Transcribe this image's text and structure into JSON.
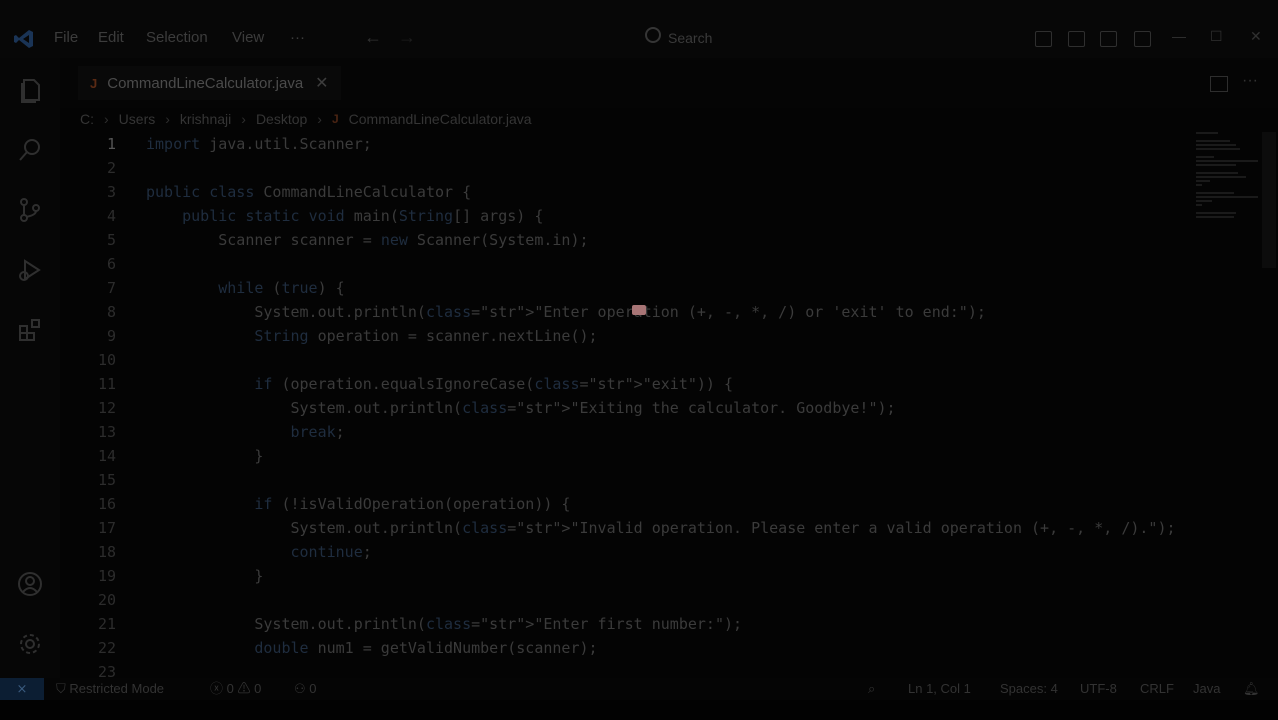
{
  "menu": {
    "file": "File",
    "edit": "Edit",
    "selection": "Selection",
    "view": "View",
    "more": "···"
  },
  "title_search": "Search",
  "tab": {
    "icon": "J",
    "label": "CommandLineCalculator.java",
    "close": "✕"
  },
  "breadcrumb": [
    "C:",
    "Users",
    "krishnaji",
    "Desktop",
    "CommandLineCalculator.java"
  ],
  "breadcrumb_java_icon": "J",
  "editor": {
    "line_numbers": [
      "1",
      "2",
      "3",
      "4",
      "5",
      "6",
      "7",
      "8",
      "9",
      "10",
      "11",
      "12",
      "13",
      "14",
      "15",
      "16",
      "17",
      "18",
      "19",
      "20",
      "21",
      "22",
      "23"
    ],
    "code_lines": [
      "import java.util.Scanner;",
      "",
      "public class CommandLineCalculator {",
      "    public static void main(String[] args) {",
      "        Scanner scanner = new Scanner(System.in);",
      "",
      "        while (true) {",
      "            System.out.println(\"Enter operation (+, -, *, /) or 'exit' to end:\");",
      "            String operation = scanner.nextLine();",
      "",
      "            if (operation.equalsIgnoreCase(\"exit\")) {",
      "                System.out.println(\"Exiting the calculator. Goodbye!\");",
      "                break;",
      "            }",
      "",
      "            if (!isValidOperation(operation)) {",
      "                System.out.println(\"Invalid operation. Please enter a valid operation (+, -, *, /).\");",
      "                continue;",
      "            }",
      "",
      "            System.out.println(\"Enter first number:\");",
      "            double num1 = getValidNumber(scanner);",
      ""
    ]
  },
  "status": {
    "remote_icon": "⨯",
    "restricted": "Restricted Mode",
    "errors": "0",
    "warnings": "0",
    "ports": "0",
    "position": "Ln 1, Col 1",
    "spaces": "Spaces: 4",
    "encoding": "UTF-8",
    "eol": "CRLF",
    "language": "Java"
  },
  "colors": {
    "accent_remote": "#0c1e33",
    "java_icon": "#5a2a14"
  },
  "icons": [
    "vscode-logo-icon",
    "files-icon",
    "search-icon",
    "source-control-icon",
    "run-debug-icon",
    "extensions-icon",
    "account-icon",
    "settings-gear-icon",
    "bell-icon"
  ]
}
